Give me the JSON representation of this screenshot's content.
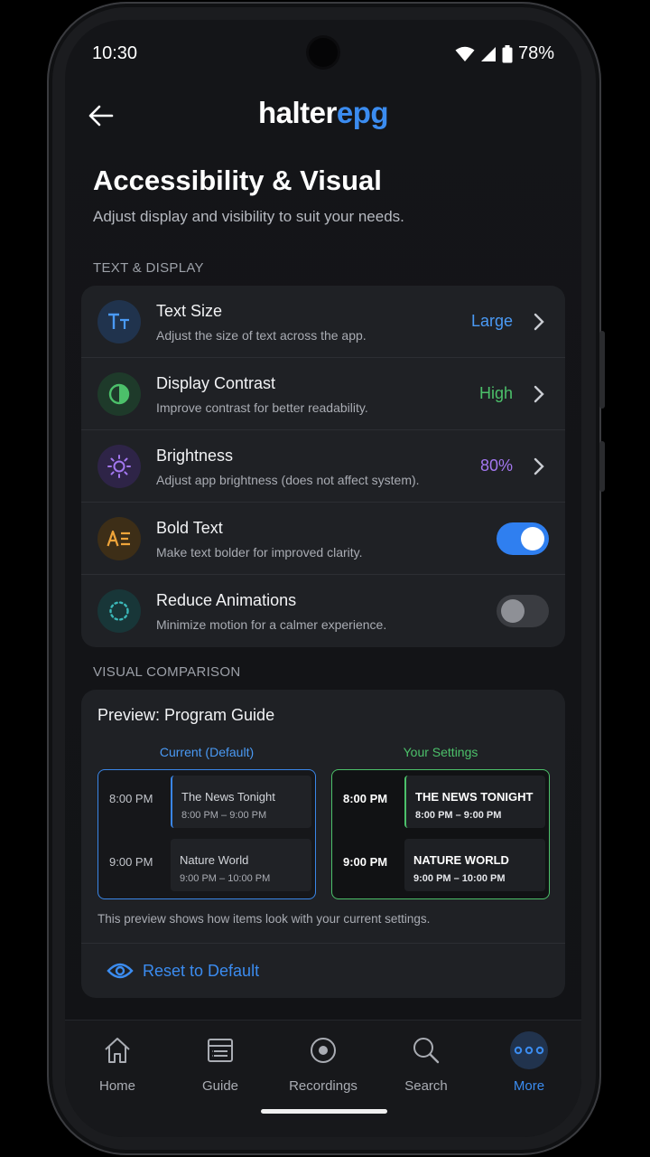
{
  "status": {
    "time": "10:30",
    "battery": "78%"
  },
  "header": {
    "logo_part1": "halter",
    "logo_part2": "epg"
  },
  "page": {
    "title": "Accessibility & Visual",
    "subtitle": "Adjust display and visibility to suit your needs."
  },
  "sections": {
    "text_display": "TEXT & DISPLAY",
    "visual_comparison": "VISUAL COMPARISON"
  },
  "settings": [
    {
      "icon": "text-size-icon",
      "label": "Text Size",
      "desc": "Adjust the size of text across the app.",
      "value": "Large",
      "value_color": "#4a9af5",
      "control": "chevron"
    },
    {
      "icon": "contrast-icon",
      "label": "Display Contrast",
      "desc": "Improve contrast for better readability.",
      "value": "High",
      "value_color": "#4cc06a",
      "control": "chevron"
    },
    {
      "icon": "brightness-icon",
      "label": "Brightness",
      "desc": "Adjust app brightness (does not affect system).",
      "value": "80%",
      "value_color": "#a377f0",
      "control": "chevron"
    },
    {
      "icon": "bold-text-icon",
      "label": "Bold Text",
      "desc": "Make text bolder for improved clarity.",
      "on": true,
      "control": "toggle"
    },
    {
      "icon": "animation-icon",
      "label": "Reduce Animations",
      "desc": "Minimize motion for a calmer experience.",
      "on": false,
      "control": "toggle"
    }
  ],
  "preview": {
    "title": "Preview: Program Guide",
    "current_label": "Current (Default)",
    "settings_label": "Your Settings",
    "current": [
      {
        "time": "8:00 PM",
        "name": "The News Tonight",
        "range": "8:00 PM – 9:00 PM"
      },
      {
        "time": "9:00 PM",
        "name": "Nature World",
        "range": "9:00 PM – 10:00 PM"
      }
    ],
    "yours": [
      {
        "time": "8:00 PM",
        "name": "THE NEWS TONIGHT",
        "range": "8:00 PM – 9:00 PM"
      },
      {
        "time": "9:00 PM",
        "name": "NATURE WORLD",
        "range": "9:00 PM – 10:00 PM"
      }
    ],
    "note": "This preview shows how items look with your current settings.",
    "reset_label": "Reset to Default"
  },
  "nav": [
    {
      "label": "Home",
      "icon": "home-icon",
      "active": false
    },
    {
      "label": "Guide",
      "icon": "guide-icon",
      "active": false
    },
    {
      "label": "Recordings",
      "icon": "recordings-icon",
      "active": false
    },
    {
      "label": "Search",
      "icon": "search-icon",
      "active": false
    },
    {
      "label": "More",
      "icon": "more-icon",
      "active": true
    }
  ],
  "colors": {
    "accent": "#3b8cf0",
    "green": "#4cc06a",
    "purple": "#a377f0",
    "orange": "#f0a53a",
    "teal": "#3bb7b8"
  }
}
